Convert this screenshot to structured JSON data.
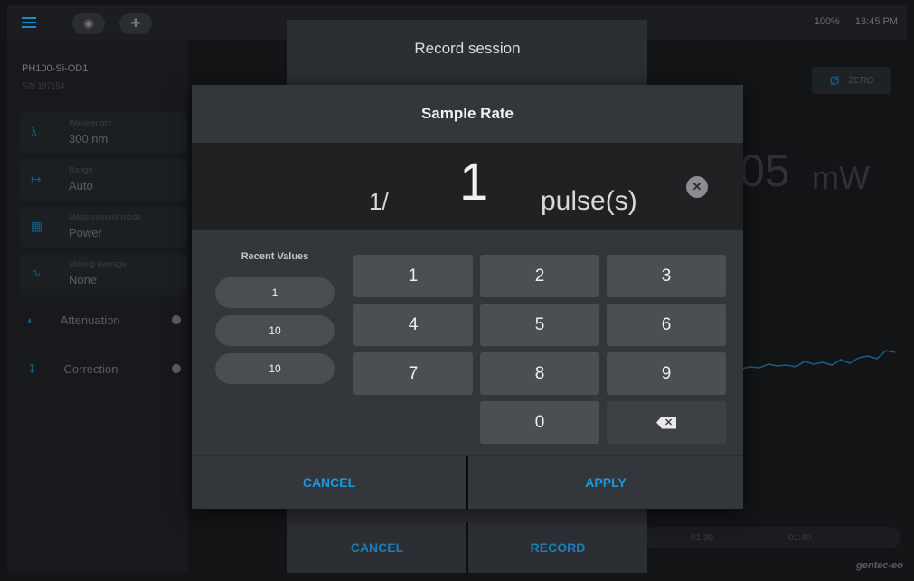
{
  "app": {
    "status": {
      "battery": "100%",
      "time": "13:45 PM"
    },
    "device": {
      "name": "PH100-Si-OD1",
      "serial": "S/N 197154"
    },
    "sidebar": {
      "items": [
        {
          "caption": "Wavelength",
          "value": "300 nm",
          "icon": "lambda-icon"
        },
        {
          "caption": "Range",
          "value": "Auto",
          "icon": "range-icon"
        },
        {
          "caption": "Measurement mode",
          "value": "Power",
          "icon": "grid-icon"
        },
        {
          "caption": "Moving average",
          "value": "None",
          "icon": "wave-icon"
        }
      ],
      "toggles": [
        {
          "label": "Attenuation",
          "icon": "attenuation-icon"
        },
        {
          "label": "Correction",
          "icon": "correction-icon"
        }
      ]
    },
    "zero_label": "ZERO",
    "reading": {
      "partial": "05",
      "unit": "mW"
    },
    "timeline": [
      "01:30",
      "01:40"
    ],
    "logo": "gentec-eo"
  },
  "record_dialog": {
    "title": "Record session",
    "cancel": "CANCEL",
    "record": "RECORD"
  },
  "sample_rate_dialog": {
    "title": "Sample Rate",
    "prefix": "1/",
    "value": "1",
    "unit": "pulse(s)",
    "recent_title": "Recent Values",
    "recent": [
      "1",
      "10",
      "10"
    ],
    "keys": [
      "1",
      "2",
      "3",
      "4",
      "5",
      "6",
      "7",
      "8",
      "9",
      "0"
    ],
    "cancel": "CANCEL",
    "apply": "APPLY"
  },
  "colors": {
    "accent": "#1a9ae0",
    "dialog_bg": "#33363a",
    "key_bg": "#4b4e52"
  }
}
